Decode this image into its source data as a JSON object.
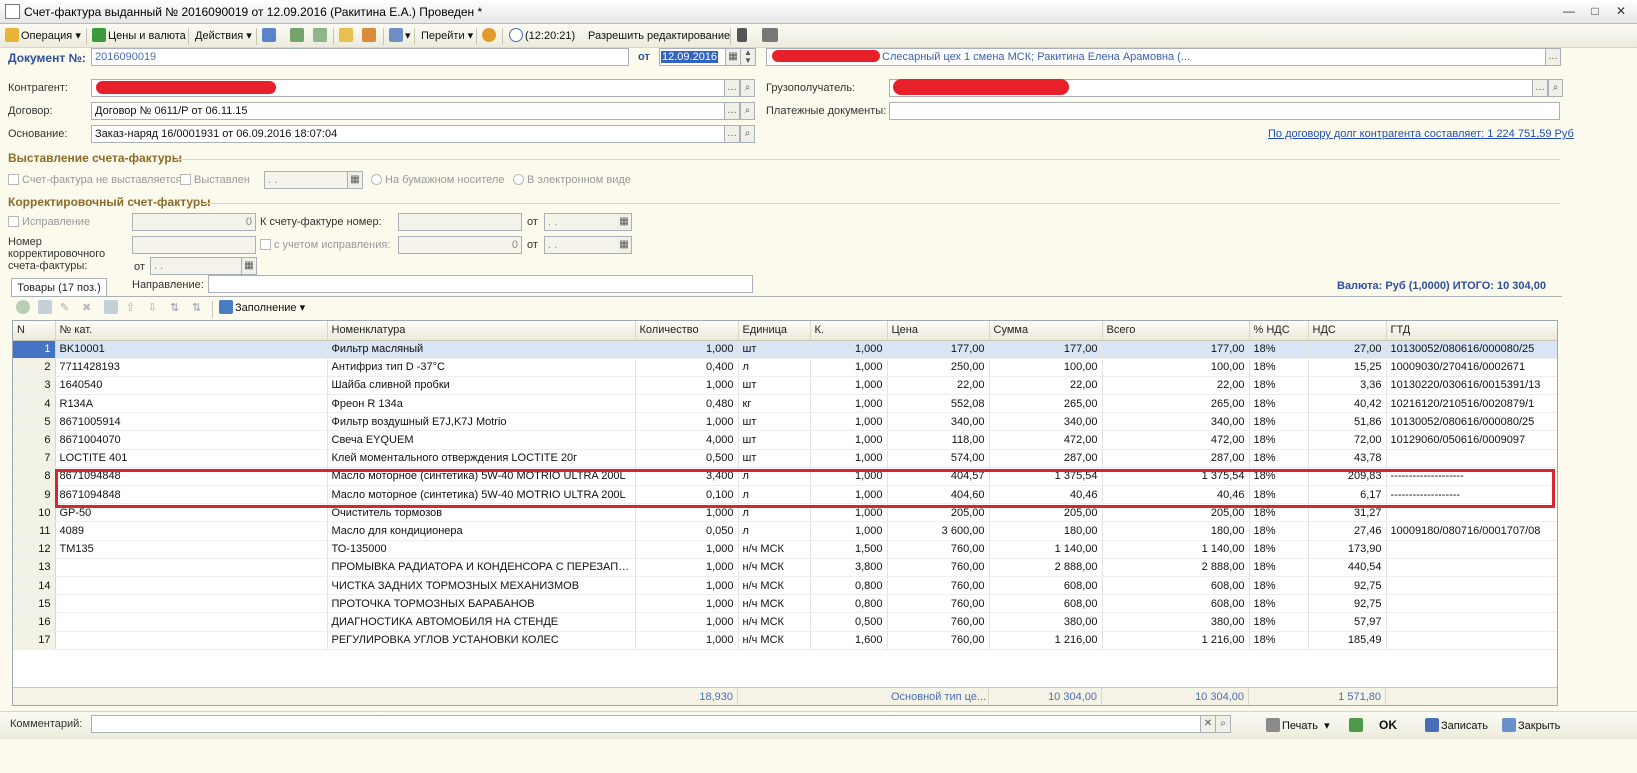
{
  "window": {
    "title": "Счет-фактура выданный № 2016090019 от 12.09.2016 (Ракитина Е.А.) Проведен *",
    "min": "—",
    "max": "□",
    "close": "✕"
  },
  "toolbar": {
    "operation": "Операция",
    "prices": "Цены и валюта",
    "actions": "Действия",
    "goto": "Перейти",
    "time": "(12:20:21)",
    "allow_edit": "Разрешить редактирование"
  },
  "header": {
    "doc_label": "Документ №:",
    "doc_number": "2016090019",
    "date_label": "от",
    "date": "12.09.2016",
    "org_text": "Слесарный цех 1 смена МСК; Ракитина Елена Арамовна (..."
  },
  "fields": {
    "contractor_label": "Контрагент:",
    "contract_label": "Договор:",
    "contract_value": "Договор № 0611/Р от 06.11.15",
    "basis_label": "Основание:",
    "basis_value": "Заказ-наряд 16/0001931 от 06.09.2016 18:07:04",
    "consignee_label": "Грузополучатель:",
    "paydocs_label": "Платежные документы:",
    "debt_link": "По договору долг контрагента составляет: 1 224 751,59 Руб"
  },
  "issue": {
    "title": "Выставление счета-фактуры",
    "not_issued": "Счет-фактура не выставляется",
    "issued": "Выставлен",
    "date_placeholder": ". .",
    "paper": "На бумажном носителе",
    "electronic": "В электронном виде"
  },
  "correction": {
    "title": "Корректировочный счет-фактуры",
    "fix": "Исправление",
    "fix_value": "0",
    "to_invoice": "К счету-фактуре номер:",
    "from": "от",
    "date_placeholder": ". .",
    "number_label": "Номер корректировочного счета-фактуры:",
    "with_fix": "с учетом исправления:",
    "with_fix_value": "0",
    "direction_label": "Направление:"
  },
  "currency_total": "Валюта: Руб (1,0000) ИТОГО: 10 304,00",
  "tab_goods": "Товары (17 поз.)",
  "grid_toolbar": {
    "fill": "Заполнение"
  },
  "columns": [
    "N",
    "№ кат.",
    "Номенклатура",
    "Количество",
    "Единица",
    "К.",
    "Цена",
    "Сумма",
    "Всего",
    "% НДС",
    "НДС",
    "ГТД"
  ],
  "rows": [
    [
      "1",
      "BK10001",
      "Фильтр масляный",
      "1,000",
      "шт",
      "1,000",
      "177,00",
      "177,00",
      "177,00",
      "18%",
      "27,00",
      "10130052/080616/000080/25"
    ],
    [
      "2",
      "7711428193",
      "Антифриз тип D -37°C",
      "0,400",
      "л",
      "1,000",
      "250,00",
      "100,00",
      "100,00",
      "18%",
      "15,25",
      "10009030/270416/0002671"
    ],
    [
      "3",
      "1640540",
      "Шайба сливной пробки",
      "1,000",
      "шт",
      "1,000",
      "22,00",
      "22,00",
      "22,00",
      "18%",
      "3,36",
      "10130220/030616/0015391/13"
    ],
    [
      "4",
      "R134A",
      "Фреон R 134a",
      "0,480",
      "кг",
      "1,000",
      "552,08",
      "265,00",
      "265,00",
      "18%",
      "40,42",
      "10216120/210516/0020879/1"
    ],
    [
      "5",
      "8671005914",
      "Фильтр воздушный E7J,K7J Motrio",
      "1,000",
      "шт",
      "1,000",
      "340,00",
      "340,00",
      "340,00",
      "18%",
      "51,86",
      "10130052/080616/000080/25"
    ],
    [
      "6",
      "8671004070",
      "Свеча EYQUEM",
      "4,000",
      "шт",
      "1,000",
      "118,00",
      "472,00",
      "472,00",
      "18%",
      "72,00",
      "10129060/050616/0009097"
    ],
    [
      "7",
      "LOCTITE 401",
      "Клей  моментального отверждения  LOCTITE 20г",
      "0,500",
      "шт",
      "1,000",
      "574,00",
      "287,00",
      "287,00",
      "18%",
      "43,78",
      ""
    ],
    [
      "8",
      "8671094848",
      "Масло моторное (синтетика) 5W-40 MOTRIO ULTRA  200L",
      "3,400",
      "л",
      "1,000",
      "404,57",
      "1 375,54",
      "1 375,54",
      "18%",
      "209,83",
      "--------------------"
    ],
    [
      "9",
      "8671094848",
      "Масло моторное (синтетика) 5W-40 MOTRIO ULTRA  200L",
      "0,100",
      "л",
      "1,000",
      "404,60",
      "40,46",
      "40,46",
      "18%",
      "6,17",
      "-------------------"
    ],
    [
      "10",
      "GP-50",
      "Очиститель тормозов",
      "1,000",
      "л",
      "1,000",
      "205,00",
      "205,00",
      "205,00",
      "18%",
      "31,27",
      ""
    ],
    [
      "11",
      "4089",
      "Масло для кондиционера",
      "0,050",
      "л",
      "1,000",
      "3 600,00",
      "180,00",
      "180,00",
      "18%",
      "27,46",
      "10009180/080716/0001707/08"
    ],
    [
      "12",
      "TM135",
      "ТО-135000",
      "1,000",
      "н/ч МСК",
      "1,500",
      "760,00",
      "1 140,00",
      "1 140,00",
      "18%",
      "173,90",
      ""
    ],
    [
      "13",
      "",
      "ПРОМЫВКА РАДИАТОРА И КОНДЕНСОРА С ПЕРЕЗАПРАВКОЙ",
      "1,000",
      "н/ч МСК",
      "3,800",
      "760,00",
      "2 888,00",
      "2 888,00",
      "18%",
      "440,54",
      ""
    ],
    [
      "14",
      "",
      "ЧИСТКА ЗАДНИХ ТОРМОЗНЫХ МЕХАНИЗМОВ",
      "1,000",
      "н/ч МСК",
      "0,800",
      "760,00",
      "608,00",
      "608,00",
      "18%",
      "92,75",
      ""
    ],
    [
      "15",
      "",
      "ПРОТОЧКА ТОРМОЗНЫХ БАРАБАНОВ",
      "1,000",
      "н/ч МСК",
      "0,800",
      "760,00",
      "608,00",
      "608,00",
      "18%",
      "92,75",
      ""
    ],
    [
      "16",
      "",
      "ДИАГНОСТИКА АВТОМОБИЛЯ НА СТЕНДЕ",
      "1,000",
      "н/ч МСК",
      "0,500",
      "760,00",
      "380,00",
      "380,00",
      "18%",
      "57,97",
      ""
    ],
    [
      "17",
      "",
      "РЕГУЛИРОВКА УГЛОВ УСТАНОВКИ КОЛЕС",
      "1,000",
      "н/ч МСК",
      "1,600",
      "760,00",
      "1 216,00",
      "1 216,00",
      "18%",
      "185,49",
      ""
    ]
  ],
  "totals": {
    "qty": "18,930",
    "price_type": "Основной тип це...",
    "sum": "10 304,00",
    "total": "10 304,00",
    "vat": "1 571,80"
  },
  "bottom": {
    "comment_label": "Комментарий:",
    "print": "Печать",
    "ok": "OK",
    "save": "Записать",
    "close": "Закрыть"
  },
  "colors": {
    "selection": "#4472c4",
    "highlight": "#d6262f",
    "section": "#8b6b2a",
    "link": "#1f4fb5"
  }
}
